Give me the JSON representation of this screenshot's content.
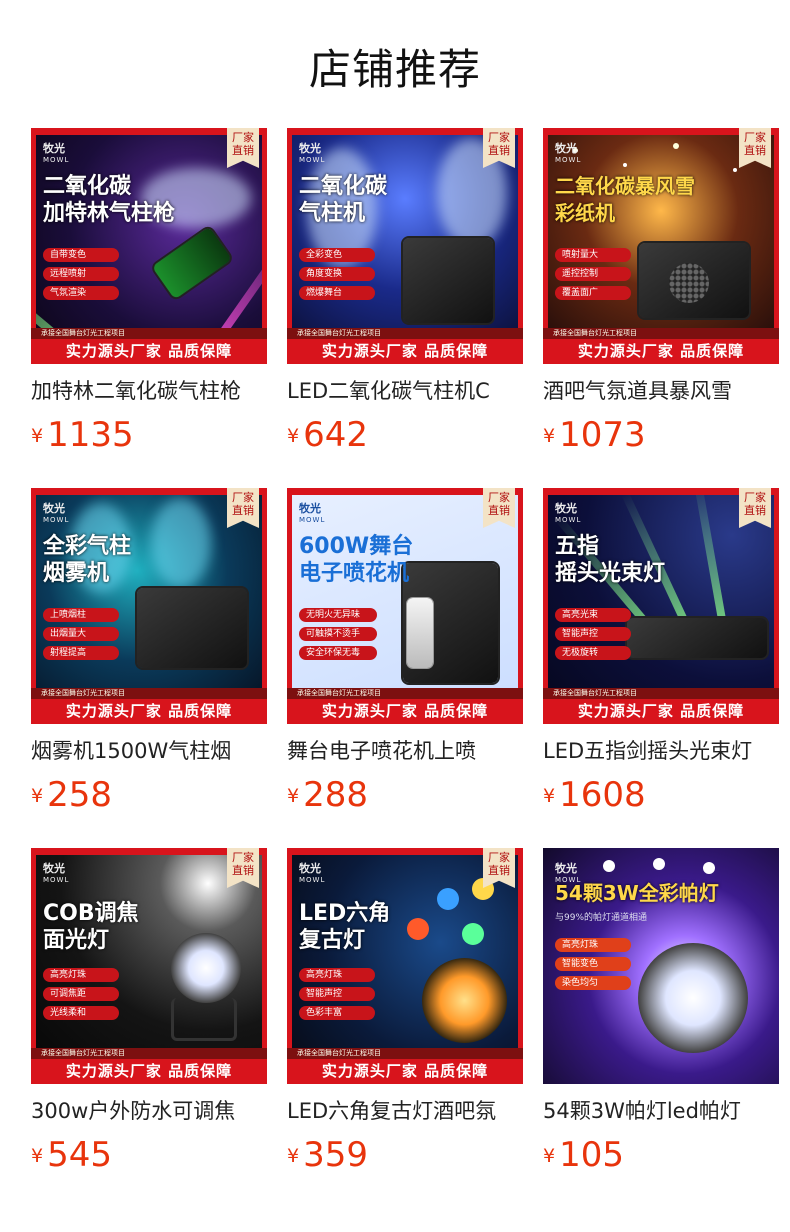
{
  "page": {
    "title": "店铺推荐"
  },
  "common": {
    "brand": "牧光",
    "brand_en": "MOWL",
    "badge": "厂家\n直销",
    "strap": "承接全国舞台灯光工程项目",
    "banner": "实力源头厂家 品质保障",
    "currency": "¥"
  },
  "products": [
    {
      "name": "加特林二氧化碳气柱枪",
      "price": "1135",
      "headline": "二氧化碳\n加特林气柱枪",
      "features": [
        "自带变色",
        "远程喷射",
        "气氛渲染"
      ]
    },
    {
      "name": "LED二氧化碳气柱机C",
      "price": "642",
      "headline": "二氧化碳\n气柱机",
      "features": [
        "全彩变色",
        "角度变换",
        "燃爆舞台"
      ]
    },
    {
      "name": "酒吧气氛道具暴风雪",
      "price": "1073",
      "headline": "二氧化碳暴风雪\n彩纸机",
      "features": [
        "喷射量大",
        "遥控控制",
        "覆盖面广"
      ]
    },
    {
      "name": "烟雾机1500W气柱烟",
      "price": "258",
      "headline": "全彩气柱\n烟雾机",
      "features": [
        "上喷烟柱",
        "出烟量大",
        "射程提高"
      ]
    },
    {
      "name": "舞台电子喷花机上喷",
      "price": "288",
      "headline": "600W舞台\n电子喷花机",
      "features": [
        "无明火无异味",
        "可触摸不烫手",
        "安全环保无毒"
      ]
    },
    {
      "name": "LED五指剑摇头光束灯",
      "price": "1608",
      "headline": "五指\n摇头光束灯",
      "features": [
        "高亮光束",
        "智能声控",
        "无极旋转"
      ]
    },
    {
      "name": "300w户外防水可调焦",
      "price": "545",
      "headline": "COB调焦\n面光灯",
      "features": [
        "高亮灯珠",
        "可调焦距",
        "光线柔和"
      ]
    },
    {
      "name": "LED六角复古灯酒吧氛",
      "price": "359",
      "headline": "LED六角\n复古灯",
      "features": [
        "高亮灯珠",
        "智能声控",
        "色彩丰富"
      ]
    },
    {
      "name": "54颗3W帕灯led帕灯",
      "price": "105",
      "headline": "54颗3W全彩帕灯",
      "subline": "与99%的帕灯通道相通",
      "features": [
        "高亮灯珠",
        "智能变色",
        "染色均匀"
      ]
    }
  ]
}
